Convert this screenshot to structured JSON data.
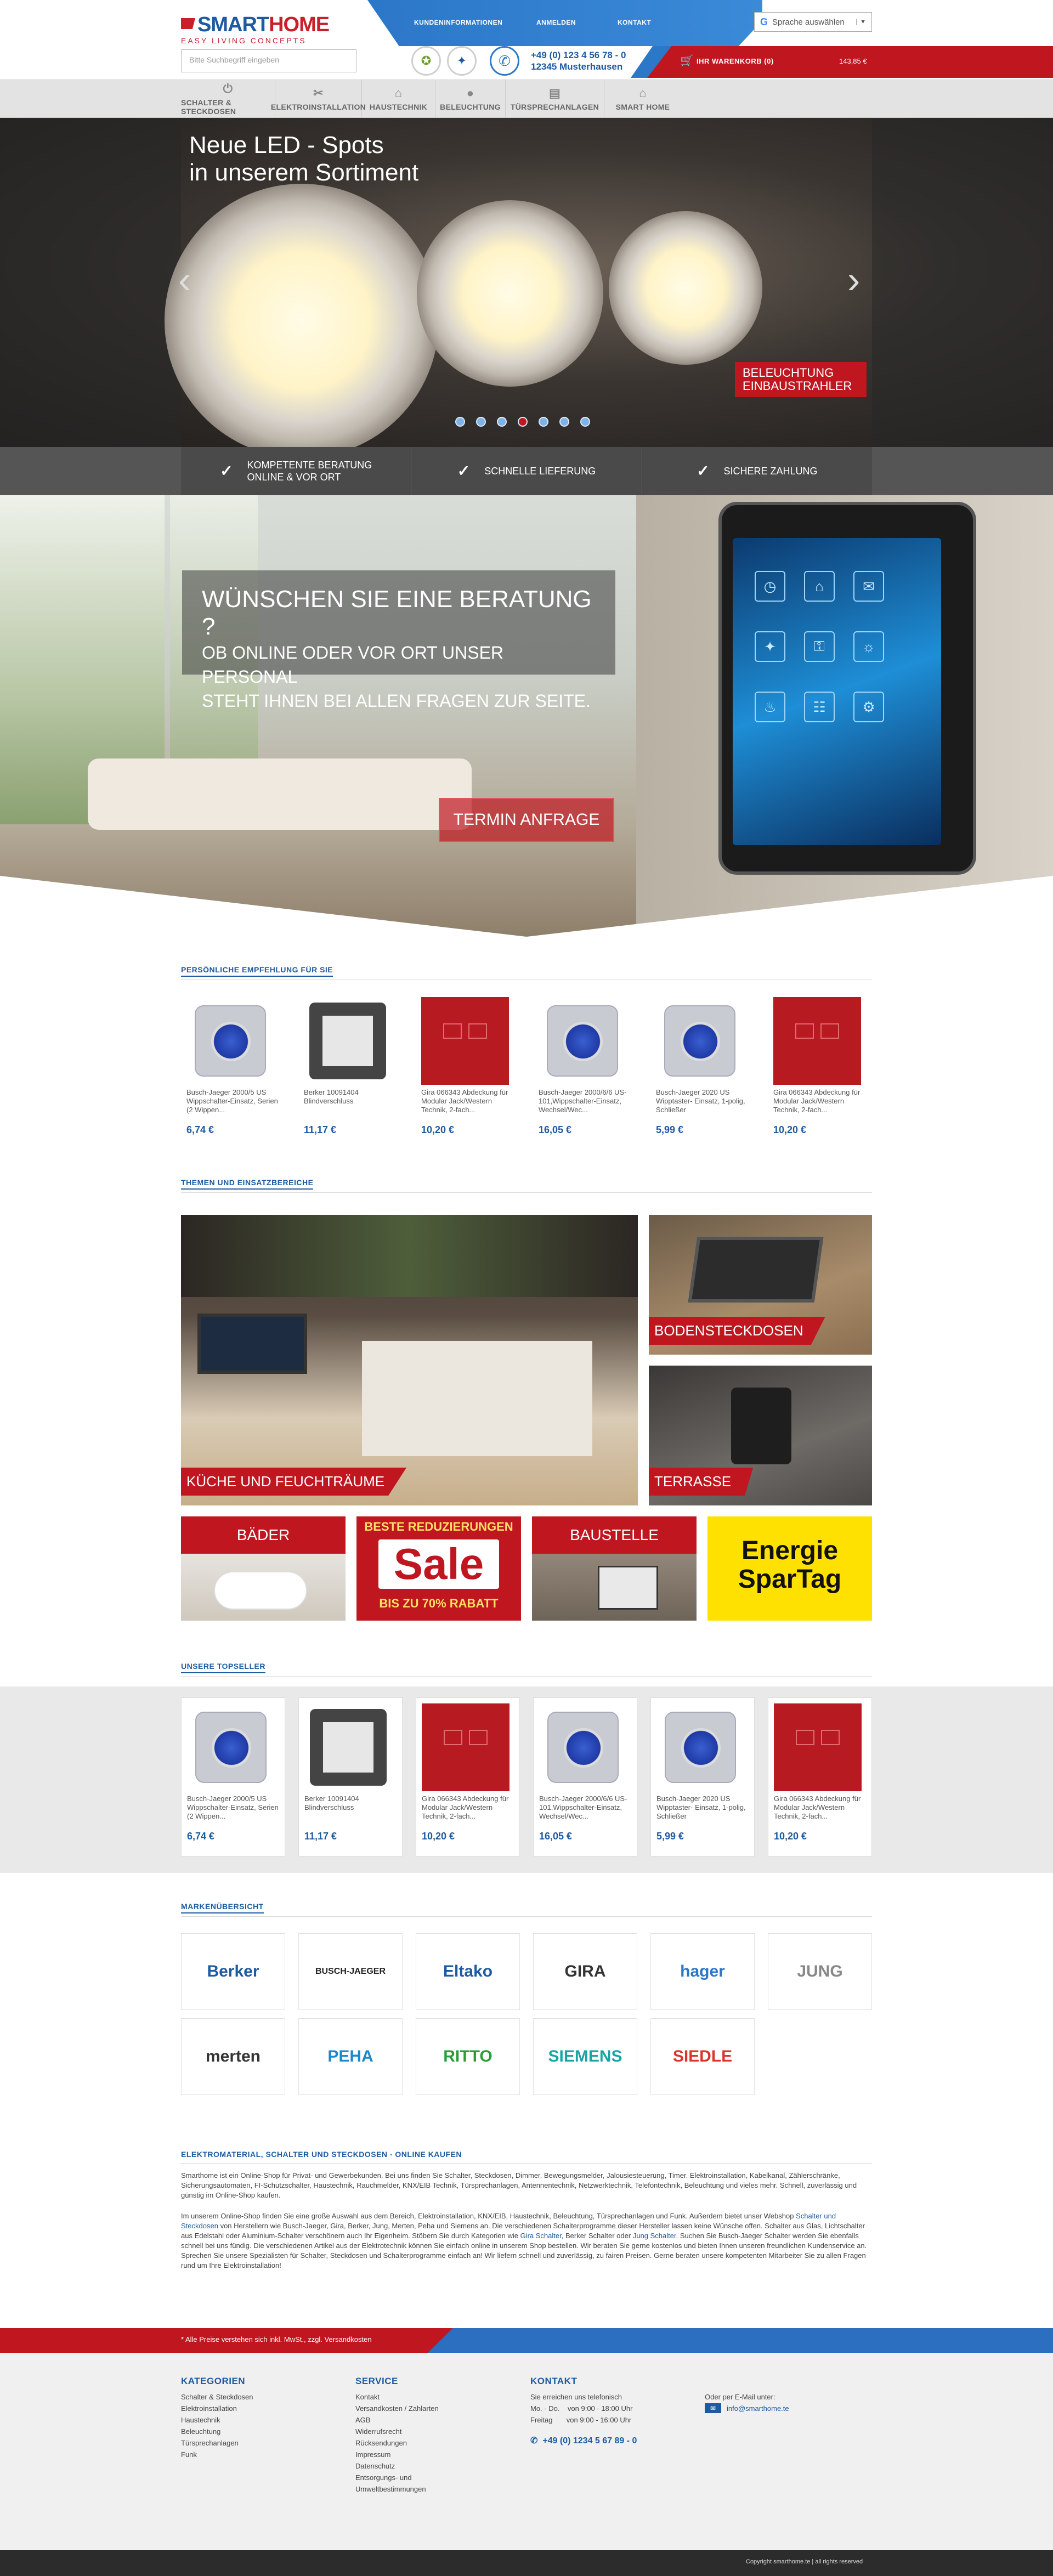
{
  "header": {
    "logo_main_1": "SMART",
    "logo_main_2": "HOME",
    "logo_sub": "EASY LIVING CONCEPTS",
    "top_links": [
      "KUNDENINFORMATIONEN",
      "ANMELDEN",
      "KONTAKT"
    ],
    "language": "Sprache auswählen",
    "search_placeholder": "Bitte Suchbegriff eingeben",
    "phone": "+49 (0) 123 4 56 78 - 0",
    "city": "12345 Musterhausen",
    "cart_label": "IHR WARENKORB (0)",
    "cart_sum": "143,85 €"
  },
  "nav": {
    "items": [
      {
        "label": "SCHALTER & STECKDOSEN",
        "icon": "power-icon"
      },
      {
        "label": "ELEKTROINSTALLATION",
        "icon": "tools-icon"
      },
      {
        "label": "HAUSTECHNIK",
        "icon": "house-icon"
      },
      {
        "label": "BELEUCHTUNG",
        "icon": "bulb-icon"
      },
      {
        "label": "TÜRSPRECHANLAGEN",
        "icon": "intercom-icon"
      },
      {
        "label": "SMART HOME",
        "icon": "smarthome-icon"
      }
    ]
  },
  "hero": {
    "title_1": "Neue LED - Spots",
    "title_2": "in unserem Sortiment",
    "badge_1": "BELEUCHTUNG",
    "badge_2": "EINBAUSTRAHLER",
    "slide_count": 7,
    "active_slide": 4
  },
  "usps": [
    {
      "line1": "KOMPETENTE BERATUNG",
      "line2": "ONLINE & VOR ORT"
    },
    {
      "line1": "SCHNELLE LIEFERUNG",
      "line2": ""
    },
    {
      "line1": "SICHERE ZAHLUNG",
      "line2": ""
    }
  ],
  "beratung": {
    "heading": "WÜNSCHEN SIE EINE BERATUNG ?",
    "text_1": "OB ONLINE ODER VOR ORT UNSER PERSONAL",
    "text_2": "STEHT IHNEN BEI ALLEN FRAGEN ZUR SEITE.",
    "button": "TERMIN ANFRAGE"
  },
  "recommend": {
    "title": "PERSÖNLICHE EMPFEHLUNG FÜR SIE",
    "products": [
      {
        "name": "Busch-Jaeger 2000/5 US Wippschalter-Einsatz, Serien (2 Wippen...",
        "price": "6,74 €",
        "img": "blue-switch"
      },
      {
        "name": "Berker 10091404 Blindverschluss",
        "price": "11,17 €",
        "img": "grey-blind"
      },
      {
        "name": "Gira 066343 Abdeckung für Modular Jack/Western Technik, 2-fach...",
        "price": "10,20 €",
        "img": "red-cover"
      },
      {
        "name": "Busch-Jaeger 2000/6/6 US-101,Wippschalter-Einsatz, Wechsel/Wec...",
        "price": "16,05 €",
        "img": "blue-switch"
      },
      {
        "name": "Busch-Jaeger 2020 US Wipptaster- Einsatz, 1-polig, Schließer",
        "price": "5,99 €",
        "img": "blue-switch"
      },
      {
        "name": "Gira 066343 Abdeckung für Modular Jack/Western Technik, 2-fach...",
        "price": "10,20 €",
        "img": "red-cover"
      }
    ]
  },
  "themes": {
    "title": "THEMEN UND EINSATZBEREICHE",
    "kitchen": "KÜCHE UND FEUCHTRÄUME",
    "floor": "BODENSTECKDOSEN",
    "terrace": "TERRASSE",
    "bath": "BÄDER",
    "sale_top": "BESTE REDUZIERUNGEN",
    "sale_word": "Sale",
    "sale_bottom": "BIS ZU 70% RABATT",
    "site": "BAUSTELLE",
    "energy_1": "Energie",
    "energy_2": "SparTag"
  },
  "topseller": {
    "title": "UNSERE TOPSELLER",
    "products": [
      {
        "name": "Busch-Jaeger 2000/5 US Wippschalter-Einsatz, Serien (2 Wippen...",
        "price": "6,74 €",
        "img": "blue-switch"
      },
      {
        "name": "Berker 10091404 Blindverschluss",
        "price": "11,17 €",
        "img": "grey-blind"
      },
      {
        "name": "Gira 066343 Abdeckung für Modular Jack/Western Technik, 2-fach...",
        "price": "10,20 €",
        "img": "red-cover"
      },
      {
        "name": "Busch-Jaeger 2000/6/6 US-101,Wippschalter-Einsatz, Wechsel/Wec...",
        "price": "16,05 €",
        "img": "blue-switch"
      },
      {
        "name": "Busch-Jaeger 2020 US Wipptaster- Einsatz, 1-polig, Schließer",
        "price": "5,99 €",
        "img": "blue-switch"
      },
      {
        "name": "Gira 066343 Abdeckung für Modular Jack/Western Technik, 2-fach...",
        "price": "10,20 €",
        "img": "red-cover"
      }
    ]
  },
  "brands": {
    "title": "MARKENÜBERSICHT",
    "items": [
      {
        "name": "Berker",
        "color": "#1d5aa0"
      },
      {
        "name": "BUSCH-JAEGER",
        "color": "#222222"
      },
      {
        "name": "Eltako",
        "color": "#1d5aa0"
      },
      {
        "name": "GIRA",
        "color": "#333333"
      },
      {
        "name": "hager",
        "color": "#2c77c8"
      },
      {
        "name": "JUNG",
        "color": "#888888"
      },
      {
        "name": "merten",
        "color": "#333333"
      },
      {
        "name": "PEHA",
        "color": "#1a8ac8"
      },
      {
        "name": "RITTO",
        "color": "#2a9d3a"
      },
      {
        "name": "SIEMENS",
        "color": "#1aa5a5"
      },
      {
        "name": "SIEDLE",
        "color": "#d9362b"
      }
    ]
  },
  "seo": {
    "title": "ELEKTROMATERIAL, SCHALTER UND STECKDOSEN - ONLINE KAUFEN",
    "p1": "Smarthome ist ein Online-Shop für Privat- und Gewerbekunden. Bei uns finden Sie Schalter, Steckdosen, Dimmer, Bewegungsmelder, Jalousiesteuerung, Timer. Elektroinstallation, Kabelkanal, Zählerschränke, Sicherungsautomaten, FI-Schutzschalter, Haustechnik, Rauchmelder, KNX/EIB Technik, Türsprechanlagen, Antennentechnik, Netzwerktechnik, Telefontechnik, Beleuchtung und vieles mehr. Schnell, zuverlässig und günstig im Online-Shop kaufen.",
    "p2a": "Im unserem Online-Shop finden Sie eine große Auswahl aus dem Bereich, Elektroinstallation, KNX/EIB, Haustechnik, Beleuchtung, Türsprechanlagen und Funk. Außerdem bietet unser Webshop",
    "p2link1": "Schalter und Steckdosen",
    "p2b": "von Herstellern wie Busch-Jaeger, Gira, Berker, Jung, Merten, Peha und Siemens an. Die verschiedenen Schalterprogramme dieser Hersteller lassen keine Wünsche offen. Schalter aus Glas, Lichtschalter aus Edelstahl oder Aluminium-Schalter verschönern auch Ihr Eigenheim. Stöbern Sie durch Kategorien wie",
    "p2link2": "Gira Schalter",
    "p2c": ", Berker Schalter oder",
    "p2link3": "Jung Schalter",
    "p2d": ". Suchen Sie Busch-Jaeger Schalter werden Sie ebenfalls schnell bei uns fündig. Die verschiedenen Artikel aus der Elektrotechnik können Sie einfach online in unserem Shop bestellen. Wir beraten Sie gerne kostenlos und bieten Ihnen unseren freundlichen Kundenservice an. Sprechen Sie unsere Spezialisten für Schalter, Steckdosen und Schalterprogramme einfach an! Wir liefern schnell und zuverlässig, zu fairen Preisen. Gerne beraten unsere kompetenten Mitarbeiter Sie zu allen Fragen rund um Ihre Elektroinstallation!"
  },
  "vat": "* Alle Preise verstehen sich inkl. MwSt., zzgl. Versandkosten",
  "footer": {
    "cat_title": "KATEGORIEN",
    "categories": [
      "Schalter & Steckdosen",
      "Elektroinstallation",
      "Haustechnik",
      "Beleuchtung",
      "Türsprechanlagen",
      "Funk"
    ],
    "service_title": "SERVICE",
    "service": [
      "Kontakt",
      "Versandkosten / Zahlarten",
      "AGB",
      "Widerrufsrecht",
      "Rücksendungen",
      "Impressum",
      "Datenschutz",
      "Entsorgungs- und",
      "Umweltbestimmungen"
    ],
    "contact_title": "KONTAKT",
    "reach": "Sie erreichen uns telefonisch",
    "hours_1": "Mo. - Do.    von 9:00 - 18:00 Uhr",
    "hours_2": "Freitag       von 9:00 - 16:00 Uhr",
    "phone": "+49 (0) 1234 5 67 89 - 0",
    "email_label": "Oder per E-Mail unter:",
    "email": "info@smarthome.te",
    "copyright": "Copyright smarthome.te | all rights reserved"
  }
}
